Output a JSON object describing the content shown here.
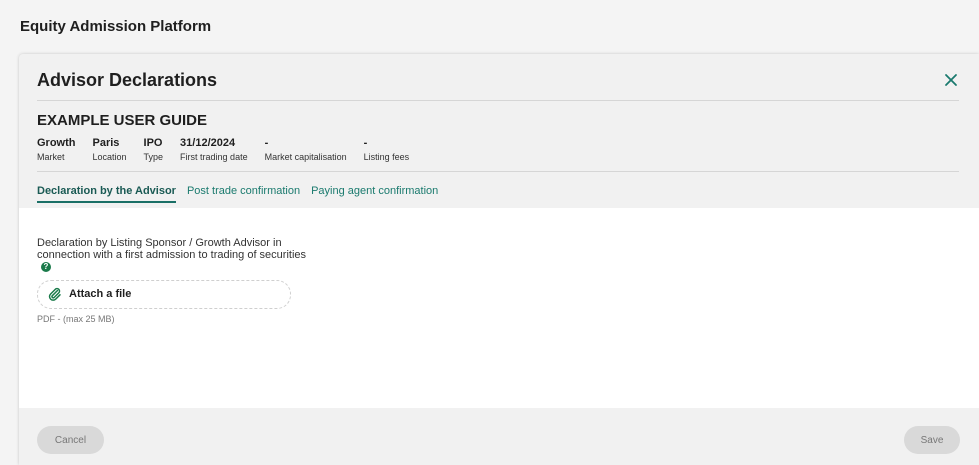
{
  "app": {
    "title": "Equity Admission Platform"
  },
  "modal": {
    "title": "Advisor Declarations",
    "issuer": "EXAMPLE USER GUIDE",
    "meta": [
      {
        "value": "Growth",
        "label": "Market"
      },
      {
        "value": "Paris",
        "label": "Location"
      },
      {
        "value": "IPO",
        "label": "Type"
      },
      {
        "value": "31/12/2024",
        "label": "First trading date"
      },
      {
        "value": "-",
        "label": "Market capitalisation"
      },
      {
        "value": "-",
        "label": "Listing fees"
      }
    ],
    "tabs": [
      {
        "label": "Declaration by the Advisor",
        "active": true
      },
      {
        "label": "Post trade confirmation",
        "active": false
      },
      {
        "label": "Paying agent confirmation",
        "active": false
      }
    ],
    "content": {
      "declaration_text": "Declaration by Listing Sponsor / Growth Advisor in connection with a first admission to trading of securities",
      "help_glyph": "?",
      "attach_label": "Attach a file",
      "file_hint": "PDF - (max 25 MB)"
    },
    "footer": {
      "cancel_label": "Cancel",
      "save_label": "Save"
    }
  },
  "colors": {
    "accent": "#1a7a6e",
    "help_icon": "#1a7a4a",
    "button_disabled_bg": "#d9d9d9"
  },
  "icons": {
    "close": "close-icon",
    "help": "help-icon",
    "attach": "paperclip-icon"
  }
}
